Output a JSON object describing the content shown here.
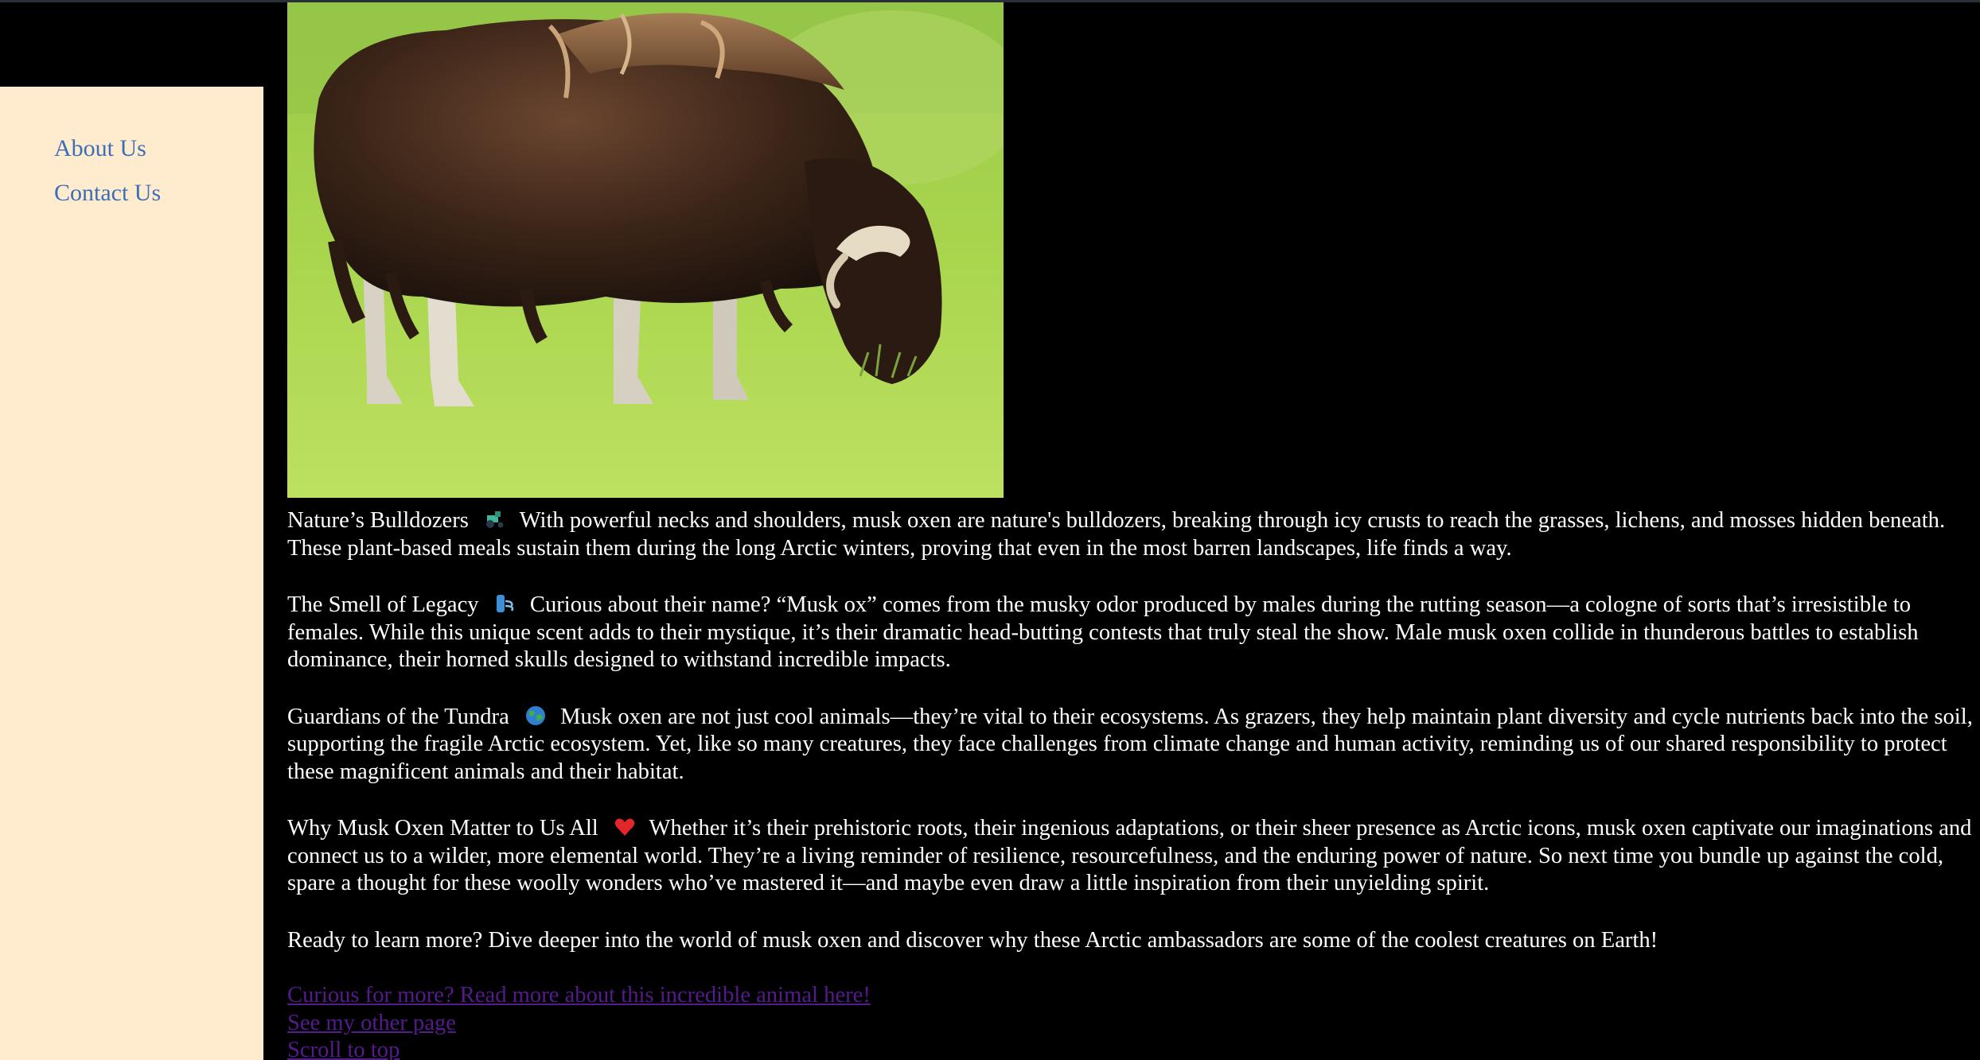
{
  "sidebar": {
    "items": [
      {
        "label": "About Us"
      },
      {
        "label": "Contact Us"
      }
    ]
  },
  "main": {
    "image": {
      "alt": "Musk ox grazing"
    },
    "paragraphs": [
      {
        "heading": "Nature’s Bulldozers",
        "emoji": "🚜",
        "emoji_icon": "tractor-icon",
        "text": "With powerful necks and shoulders, musk oxen are nature's bulldozers, breaking through icy crusts to reach the grasses, lichens, and mosses hidden beneath. These plant-based meals sustain them during the long Arctic winters, proving that even in the most barren landscapes, life finds a way."
      },
      {
        "heading": "The Smell of Legacy",
        "emoji": "🌬",
        "emoji_icon": "wind-icon",
        "text": "Curious about their name? “Musk ox” comes from the musky odor produced by males during the rutting season—a cologne of sorts that’s irresistible to females. While this unique scent adds to their mystique, it’s their dramatic head-butting contests that truly steal the show. Male musk oxen collide in thunderous battles to establish dominance, their horned skulls designed to withstand incredible impacts."
      },
      {
        "heading": "Guardians of the Tundra",
        "emoji": "🌍",
        "emoji_icon": "globe-icon",
        "text": "Musk oxen are not just cool animals—they’re vital to their ecosystems. As grazers, they help maintain plant diversity and cycle nutrients back into the soil, supporting the fragile Arctic ecosystem. Yet, like so many creatures, they face challenges from climate change and human activity, reminding us of our shared responsibility to protect these magnificent animals and their habitat."
      },
      {
        "heading": "Why Musk Oxen Matter to Us All",
        "emoji": "❤",
        "emoji_icon": "heart-icon",
        "text": "Whether it’s their prehistoric roots, their ingenious adaptations, or their sheer presence as Arctic icons, musk oxen captivate our imaginations and connect us to a wilder, more elemental world. They’re a living reminder of resilience, resourcefulness, and the enduring power of nature. So next time you bundle up against the cold, spare a thought for these woolly wonders who’ve mastered it—and maybe even draw a little inspiration from their unyielding spirit."
      }
    ],
    "closing": "Ready to learn more? Dive deeper into the world of musk oxen and discover why these Arctic ambassadors are some of the coolest creatures on Earth!",
    "links": [
      {
        "label": "Curious for more? Read more about this incredible animal here!"
      },
      {
        "label": "See my other page"
      },
      {
        "label": "Scroll to top"
      }
    ]
  },
  "colors": {
    "background": "#000000",
    "sidebar": "#ffebcd",
    "nav_link": "#3b6fb6",
    "visited_link": "#551a8b",
    "text": "#ffffff"
  }
}
